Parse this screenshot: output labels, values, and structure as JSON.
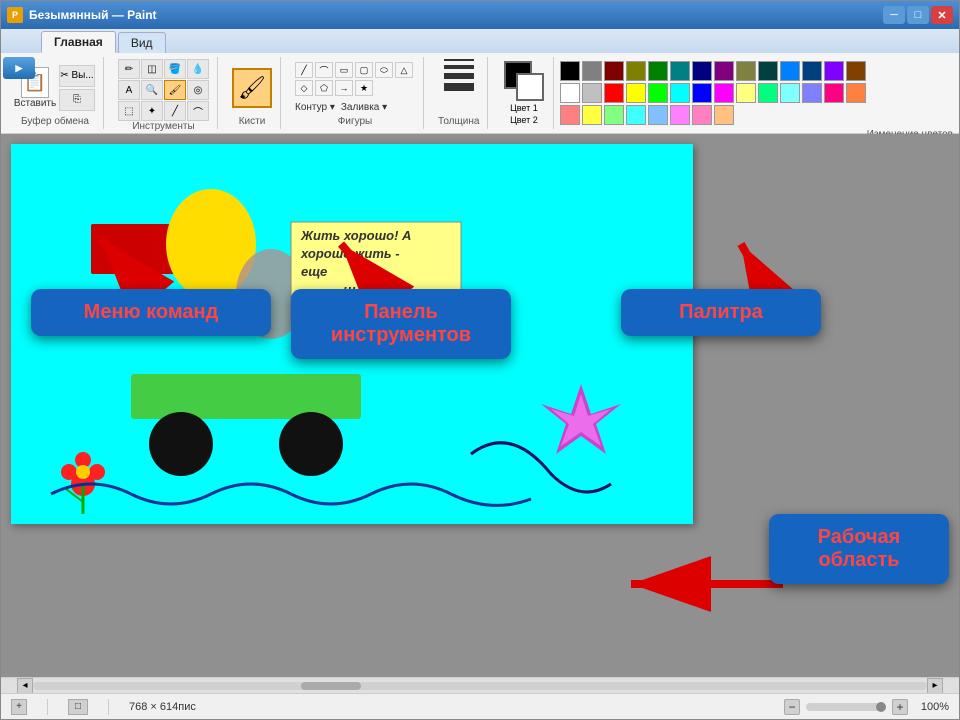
{
  "window": {
    "title": "Безымянный — Paint",
    "icon": "P"
  },
  "tabs": {
    "items": [
      "Главная",
      "Вид"
    ],
    "active": 0
  },
  "ribbon": {
    "groups": [
      {
        "label": "Буфер обмена",
        "items": [
          "Вставить",
          "Вы..."
        ]
      },
      {
        "label": "Инструменты",
        "items": []
      },
      {
        "label": "Фигуры",
        "items": []
      },
      {
        "label": "Толщина",
        "items": []
      }
    ],
    "brushes_label": "Кисти",
    "tools_label": "Инструменты",
    "shapes_label": "Фигуры",
    "contour_label": "Контур",
    "fill_label": "Заливка",
    "thickness_label": "Толщина",
    "color1_label": "Цвет 1",
    "color2_label": "Цвет 2",
    "color_change_label": "Изменение цветов"
  },
  "annotations": {
    "menu": "Меню команд",
    "toolbar": "Панель\nинструментов",
    "palette": "Палитра",
    "workspace": "Рабочая\nобласть"
  },
  "palette": {
    "colors": [
      "#000000",
      "#808080",
      "#800000",
      "#808000",
      "#008000",
      "#008080",
      "#000080",
      "#800080",
      "#808040",
      "#004040",
      "#0080FF",
      "#004080",
      "#8000FF",
      "#804000",
      "#ffffff",
      "#c0c0c0",
      "#ff0000",
      "#ffff00",
      "#00ff00",
      "#00ffff",
      "#0000ff",
      "#ff00ff",
      "#ffff80",
      "#00ff80",
      "#80ffff",
      "#8080ff",
      "#ff0080",
      "#ff8040",
      "#ff8080",
      "#ffff40",
      "#80ff80",
      "#40ffff",
      "#80c0ff",
      "#ff80ff",
      "#ff80c0",
      "#ffc080"
    ]
  },
  "status": {
    "dimensions": "768 × 614пис",
    "zoom": "100%"
  },
  "canvas": {
    "text": "Жить хорошо! А хорошо жить - еще лучше!!!"
  },
  "paint_btn": "▶"
}
